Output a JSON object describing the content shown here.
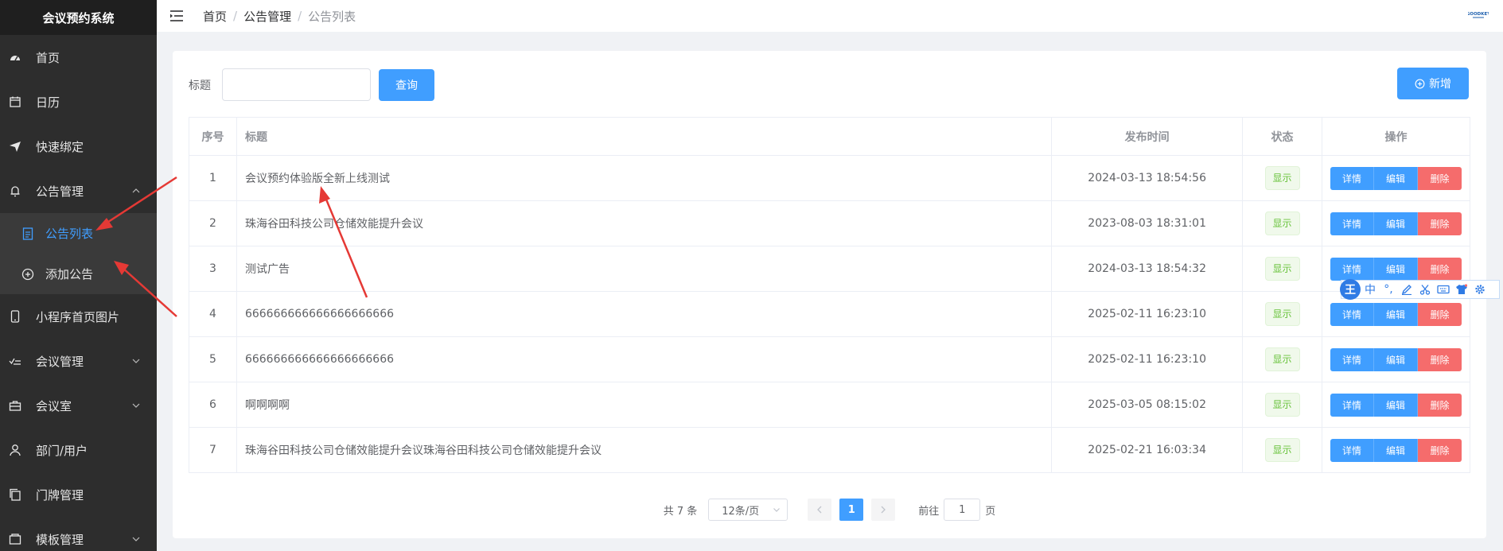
{
  "app": {
    "title": "会议预约系统"
  },
  "sidebar": {
    "items": [
      {
        "label": "首页",
        "icon": "dashboard-icon"
      },
      {
        "label": "日历",
        "icon": "calendar-icon"
      },
      {
        "label": "快速绑定",
        "icon": "paper-plane-icon"
      },
      {
        "label": "公告管理",
        "icon": "bell-icon",
        "expanded": true
      },
      {
        "label": "小程序首页图片",
        "icon": "mobile-icon"
      },
      {
        "label": "会议管理",
        "icon": "checklist-icon"
      },
      {
        "label": "会议室",
        "icon": "briefcase-icon"
      },
      {
        "label": "部门/用户",
        "icon": "user-icon"
      },
      {
        "label": "门牌管理",
        "icon": "copy-icon"
      },
      {
        "label": "模板管理",
        "icon": "template-icon"
      }
    ],
    "sub_items": [
      {
        "label": "公告列表",
        "icon": "document-icon",
        "active": true
      },
      {
        "label": "添加公告",
        "icon": "circle-plus-icon"
      }
    ]
  },
  "header": {
    "breadcrumb": [
      "首页",
      "公告管理",
      "公告列表"
    ],
    "brand_logo_text": "GOODKEY"
  },
  "search": {
    "label": "标题",
    "value": "",
    "placeholder": "",
    "query_label": "查询",
    "add_label": "新增"
  },
  "table": {
    "headers": [
      "序号",
      "标题",
      "发布时间",
      "状态",
      "操作"
    ],
    "rows": [
      {
        "no": "1",
        "title": "会议预约体验版全新上线测试",
        "time": "2024-03-13 18:54:56",
        "status": "显示"
      },
      {
        "no": "2",
        "title": "珠海谷田科技公司仓储效能提升会议",
        "time": "2023-08-03 18:31:01",
        "status": "显示"
      },
      {
        "no": "3",
        "title": "测试广告",
        "time": "2024-03-13 18:54:32",
        "status": "显示"
      },
      {
        "no": "4",
        "title": "666666666666666666666",
        "time": "2025-02-11 16:23:10",
        "status": "显示"
      },
      {
        "no": "5",
        "title": "666666666666666666666",
        "time": "2025-02-11 16:23:10",
        "status": "显示"
      },
      {
        "no": "6",
        "title": "啊啊啊啊",
        "time": "2025-03-05 08:15:02",
        "status": "显示"
      },
      {
        "no": "7",
        "title": "珠海谷田科技公司仓储效能提升会议珠海谷田科技公司仓储效能提升会议",
        "time": "2025-02-21 16:03:34",
        "status": "显示"
      }
    ],
    "ops": {
      "detail": "详情",
      "edit": "编辑",
      "delete": "删除"
    }
  },
  "pagination": {
    "total": "共 7 条",
    "page_size": "12条/页",
    "current_page": "1",
    "goto_label": "前往",
    "goto_value": "1",
    "page_unit": "页"
  },
  "ime": {
    "badge": "王",
    "mode": "中",
    "punct": "°,"
  },
  "colors": {
    "primary": "#409eff",
    "danger": "#f56c6c",
    "success": "#67c23a",
    "sidebar": "#2d2d2d",
    "annotation": "#e53935"
  }
}
